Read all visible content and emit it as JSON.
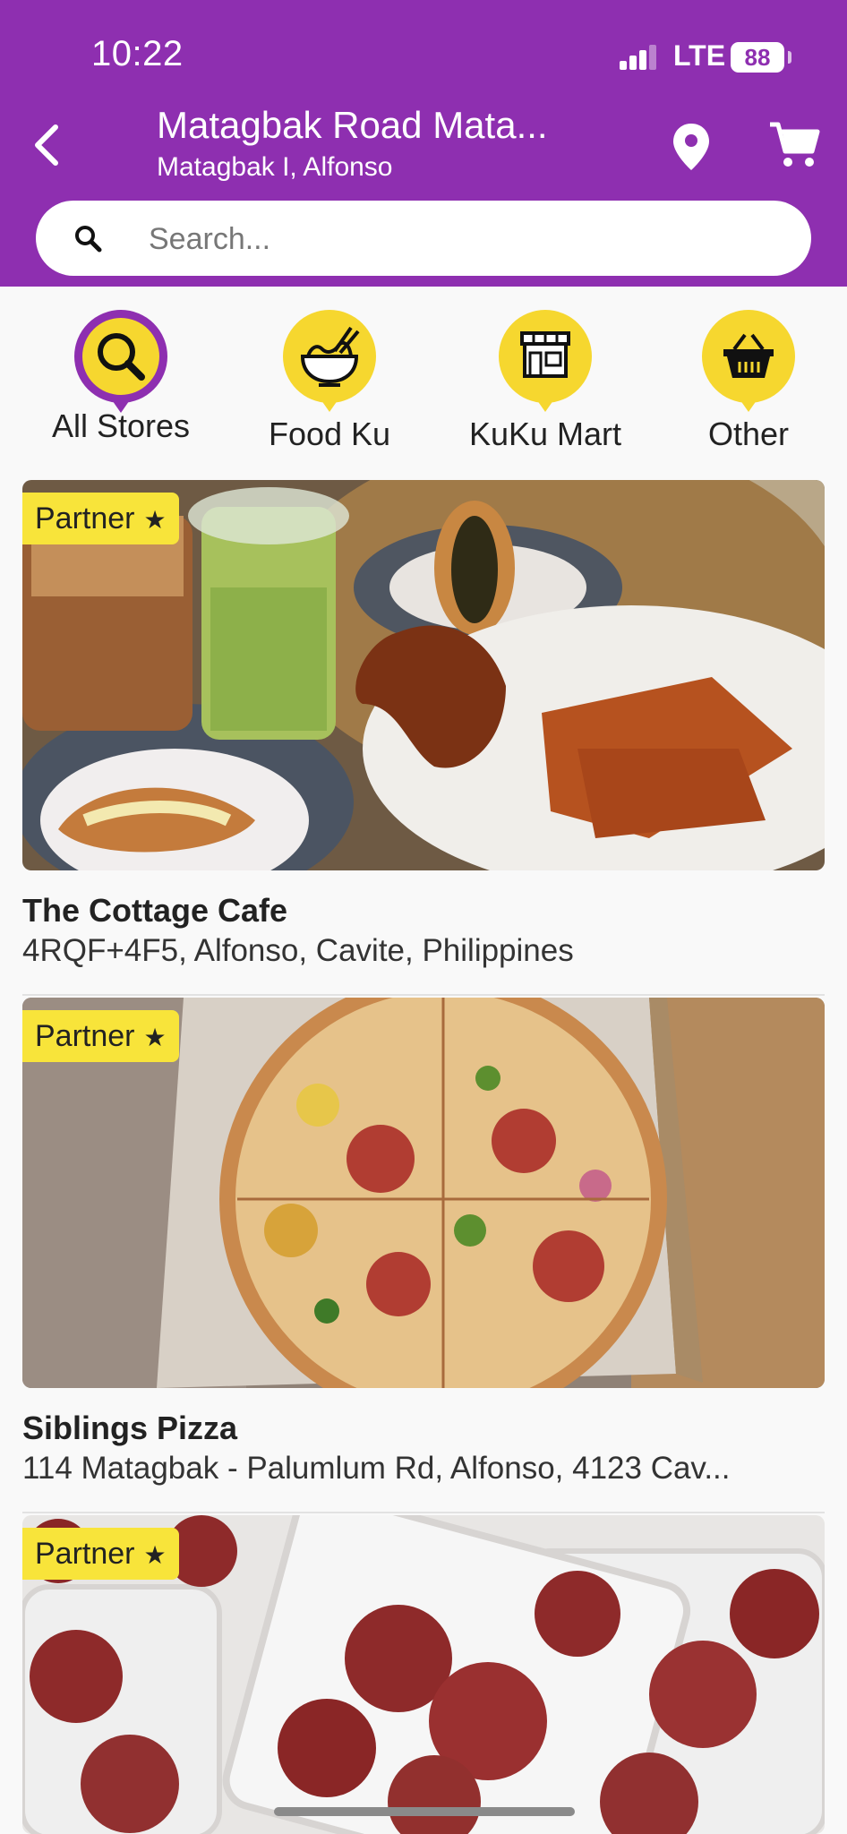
{
  "status_bar": {
    "time": "10:22",
    "network": "LTE",
    "battery": "88"
  },
  "header": {
    "title": "Matagbak Road Mata...",
    "subtitle": "Matagbak I, Alfonso",
    "back_icon": "chevron-left-icon",
    "location_icon": "map-pin-icon",
    "cart_icon": "cart-icon"
  },
  "search": {
    "placeholder": "Search..."
  },
  "categories": [
    {
      "label": "All Stores",
      "icon": "search-icon",
      "selected": true
    },
    {
      "label": "Food Ku",
      "icon": "noodle-bowl-icon",
      "selected": false
    },
    {
      "label": "KuKu Mart",
      "icon": "storefront-icon",
      "selected": false
    },
    {
      "label": "Other",
      "icon": "basket-icon",
      "selected": false
    }
  ],
  "stores": [
    {
      "badge": "Partner",
      "name": "The Cottage Cafe",
      "address": "4RQF+4F5, Alfonso, Cavite, Philippines",
      "image": "cafe drinks and waffles photo"
    },
    {
      "badge": "Partner",
      "name": "Siblings Pizza",
      "address": "114 Matagbak - Palumlum Rd, Alfonso, 4123 Cav...",
      "image": "pizza in box photo"
    },
    {
      "badge": "Partner",
      "name": "",
      "address": "",
      "image": "sliced meat trays photo"
    }
  ],
  "colors": {
    "primary": "#8e2fb0",
    "accent": "#f6d72f",
    "badge": "#f8e43a"
  }
}
